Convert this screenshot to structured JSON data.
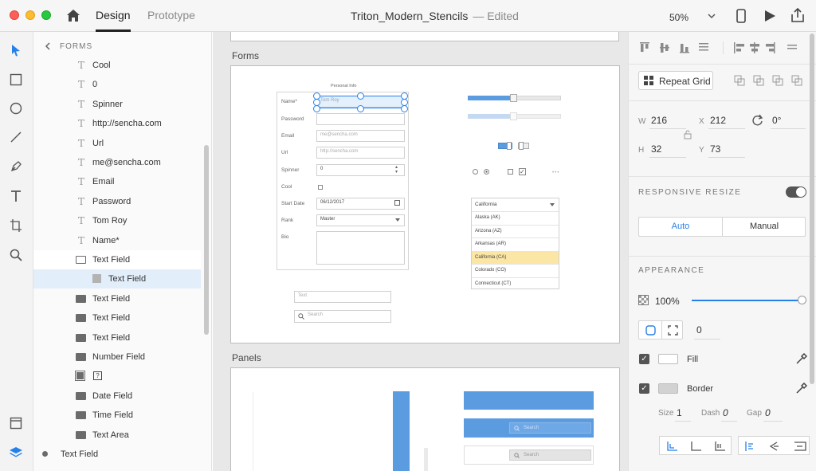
{
  "titlebar": {
    "tab_design": "Design",
    "tab_prototype": "Prototype",
    "document_name": "Triton_Modern_Stencils",
    "status": "— Edited",
    "zoom": "50%"
  },
  "toolbar": {
    "icons": [
      "select-icon",
      "rectangle-icon",
      "ellipse-icon",
      "line-icon",
      "pen-icon",
      "text-icon",
      "artboard-icon",
      "zoom-icon",
      "assets-icon",
      "layers-icon"
    ]
  },
  "layers": {
    "header": "FORMS",
    "items": [
      {
        "icon": "text",
        "label": "Cool"
      },
      {
        "icon": "text",
        "label": "0"
      },
      {
        "icon": "text",
        "label": "Spinner"
      },
      {
        "icon": "text",
        "label": "http://sencha.com"
      },
      {
        "icon": "text",
        "label": "Url"
      },
      {
        "icon": "text",
        "label": "me@sencha.com"
      },
      {
        "icon": "text",
        "label": "Email"
      },
      {
        "icon": "text",
        "label": "Password"
      },
      {
        "icon": "text",
        "label": "Tom Roy"
      },
      {
        "icon": "text",
        "label": "Name*"
      },
      {
        "icon": "folder-open",
        "label": "Text Field"
      },
      {
        "icon": "rect",
        "label": "Text Field"
      },
      {
        "icon": "folder",
        "label": "Text Field"
      },
      {
        "icon": "folder",
        "label": "Text Field"
      },
      {
        "icon": "folder",
        "label": "Text Field"
      },
      {
        "icon": "folder",
        "label": "Number Field"
      },
      {
        "icon": "symbol",
        "label": ""
      },
      {
        "icon": "folder",
        "label": "Date Field"
      },
      {
        "icon": "folder",
        "label": "Time Field"
      },
      {
        "icon": "folder",
        "label": "Text Area"
      },
      {
        "icon": "dot",
        "label": "Text Field"
      }
    ]
  },
  "canvas": {
    "artboard_forms_label": "Forms",
    "artboard_panels_label": "Panels",
    "form": {
      "title": "Personal Info",
      "rows": [
        {
          "label": "Name*",
          "value": "Tom Roy"
        },
        {
          "label": "Password",
          "value": ""
        },
        {
          "label": "Email",
          "value": "me@sencha.com"
        },
        {
          "label": "Url",
          "value": "http://sencha.com"
        },
        {
          "label": "Spinner",
          "value": "0"
        },
        {
          "label": "Cool",
          "value": ""
        },
        {
          "label": "Start Date",
          "value": "06/12/2017"
        },
        {
          "label": "Rank",
          "value": "Master"
        },
        {
          "label": "Bio",
          "value": ""
        }
      ],
      "text_placeholder": "Text",
      "search_placeholder": "Search"
    },
    "states_dropdown": {
      "selected": "California",
      "options": [
        "Alaska (AK)",
        "Arizona (AZ)",
        "Arkansas (AR)",
        "California (CA)",
        "Colorado (CO)",
        "Connecticut (CT)"
      ]
    },
    "panel_search_placeholder": "Search"
  },
  "properties": {
    "repeat_grid": "Repeat Grid",
    "w_label": "W",
    "w_value": "216",
    "h_label": "H",
    "h_value": "32",
    "x_label": "X",
    "x_value": "212",
    "y_label": "Y",
    "y_value": "73",
    "rotation": "0°",
    "responsive_resize": "RESPONSIVE RESIZE",
    "auto": "Auto",
    "manual": "Manual",
    "appearance": "APPEARANCE",
    "opacity": "100%",
    "radius": "0",
    "fill_label": "Fill",
    "border_label": "Border",
    "size_label": "Size",
    "size_value": "1",
    "dash_label": "Dash",
    "dash_value": "0",
    "gap_label": "Gap",
    "gap_value": "0",
    "accent_color": "#4a90e2"
  }
}
